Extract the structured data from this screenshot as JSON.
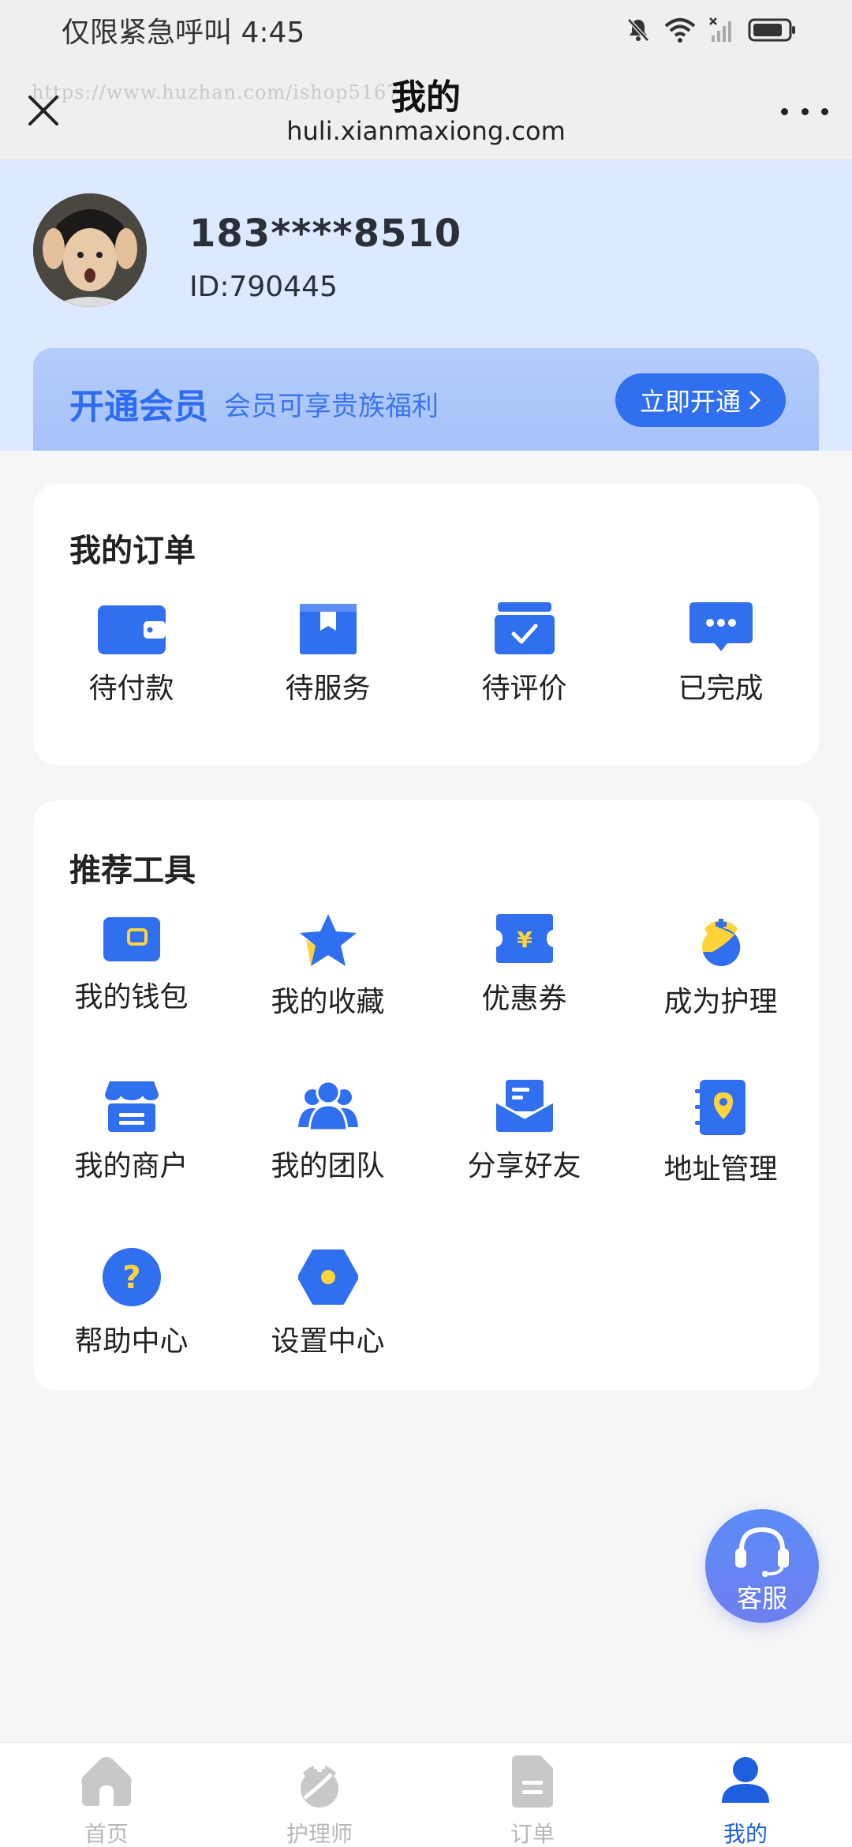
{
  "status_bar": {
    "left_text": "仅限紧急呼叫 4:45"
  },
  "title_bar": {
    "watermark": "https://www.huzhan.com/ishop5167",
    "title": "我的",
    "url": "huli.xianmaxiong.com"
  },
  "profile": {
    "phone": "183****8510",
    "id_text": "ID:790445"
  },
  "vip": {
    "title": "开通会员",
    "subtitle": "会员可享贵族福利",
    "button_label": "立即开通"
  },
  "orders": {
    "title": "我的订单",
    "items": [
      {
        "label": "待付款",
        "icon": "wallet-icon"
      },
      {
        "label": "待服务",
        "icon": "box-icon"
      },
      {
        "label": "待评价",
        "icon": "inbox-check-icon"
      },
      {
        "label": "已完成",
        "icon": "chat-dots-icon"
      }
    ]
  },
  "tools": {
    "title": "推荐工具",
    "items": [
      {
        "label": "我的钱包",
        "icon": "wallet-icon"
      },
      {
        "label": "我的收藏",
        "icon": "star-icon"
      },
      {
        "label": "优惠券",
        "icon": "coupon-icon"
      },
      {
        "label": "成为护理",
        "icon": "nurse-icon"
      },
      {
        "label": "我的商户",
        "icon": "store-icon"
      },
      {
        "label": "我的团队",
        "icon": "team-icon"
      },
      {
        "label": "分享好友",
        "icon": "share-mail-icon"
      },
      {
        "label": "地址管理",
        "icon": "address-book-icon"
      },
      {
        "label": "帮助中心",
        "icon": "help-icon"
      },
      {
        "label": "设置中心",
        "icon": "settings-icon"
      }
    ]
  },
  "service_fab": {
    "label": "客服"
  },
  "tab_bar": {
    "tabs": [
      {
        "label": "首页",
        "icon": "home-icon",
        "active": false
      },
      {
        "label": "护理师",
        "icon": "nurse-tab-icon",
        "active": false
      },
      {
        "label": "订单",
        "icon": "document-icon",
        "active": false
      },
      {
        "label": "我的",
        "icon": "user-icon",
        "active": true
      }
    ]
  },
  "colors": {
    "accent": "#2f6ff0",
    "profile_bg": "#dde9fe",
    "icon_yellow": "#ffd43b",
    "tab_inactive": "#b8b8b8"
  }
}
